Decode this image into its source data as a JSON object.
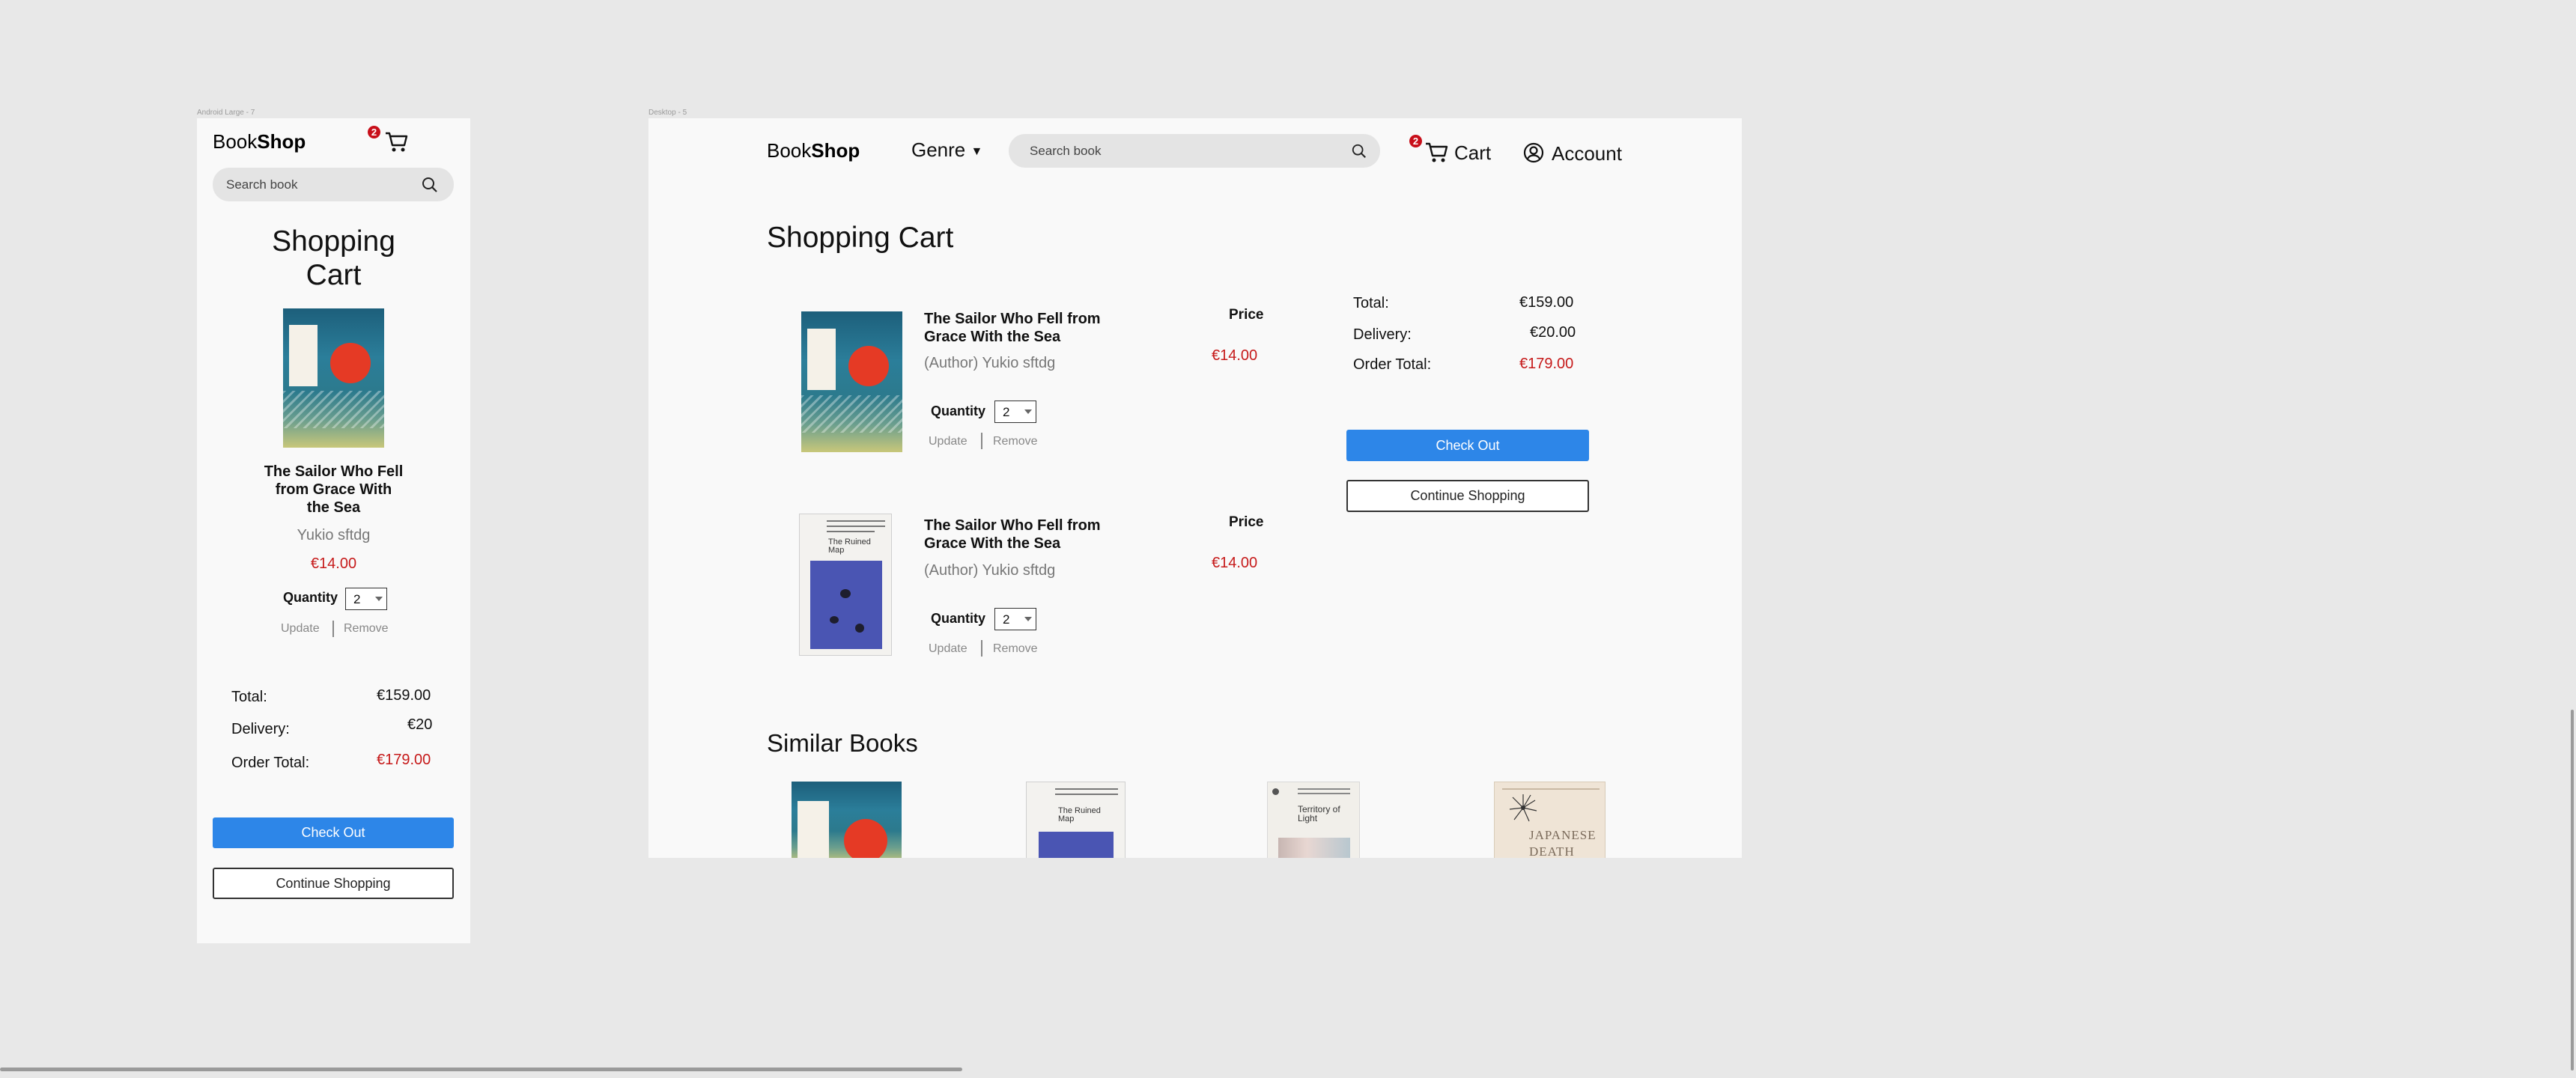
{
  "frames": {
    "mobile_label": "Android Large - 7",
    "desktop_label": "Desktop - 5"
  },
  "brand": {
    "prefix": "Book",
    "bold": "Shop"
  },
  "search": {
    "placeholder": "Search book"
  },
  "header": {
    "genre_label": "Genre",
    "cart_label": "Cart",
    "cart_count": "2",
    "account_label": "Account"
  },
  "page_title": "Shopping Cart",
  "mobile_title_line1": "Shopping",
  "mobile_title_line2": "Cart",
  "cart_items": [
    {
      "title_line1": "The Sailor Who Fell from",
      "title_line2": "Grace With the Sea",
      "author": "(Author) Yukio sftdg",
      "price_label": "Price",
      "price": "€14.00",
      "quantity_label": "Quantity",
      "quantity": "2",
      "update_label": "Update",
      "remove_label": "Remove"
    },
    {
      "title_line1": "The Sailor Who Fell from",
      "title_line2": "Grace With the Sea",
      "author": "(Author) Yukio sftdg",
      "price_label": "Price",
      "price": "€14.00",
      "quantity_label": "Quantity",
      "quantity": "2",
      "update_label": "Update",
      "remove_label": "Remove"
    }
  ],
  "mobile_item": {
    "title_line1": "The Sailor Who Fell",
    "title_line2": "from Grace With",
    "title_line3": "the Sea",
    "author": "Yukio sftdg",
    "price": "€14.00",
    "quantity_label": "Quantity",
    "quantity": "2",
    "update_label": "Update",
    "remove_label": "Remove"
  },
  "summary": {
    "total_label": "Total:",
    "total_value": "€159.00",
    "delivery_label": "Delivery:",
    "delivery_value": "€20.00",
    "order_total_label": "Order Total:",
    "order_total_value": "€179.00",
    "mobile_delivery_value": "€20"
  },
  "actions": {
    "checkout": "Check Out",
    "continue": "Continue Shopping"
  },
  "similar": {
    "title": "Similar Books",
    "cover_texts": {
      "ruined_map": "The Ruined Map",
      "territory": "Territory of Light",
      "japanese": "JAPANESE DEATH"
    }
  },
  "colors": {
    "accent": "#2d86e8",
    "price_red": "#c61a1a",
    "badge_red": "#c80f1a"
  }
}
